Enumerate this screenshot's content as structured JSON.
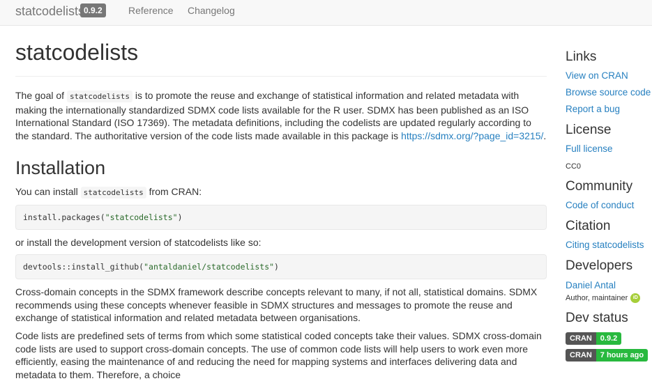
{
  "navbar": {
    "brand": "statcodelists",
    "version": "0.9.2",
    "links": [
      "Reference",
      "Changelog"
    ]
  },
  "main": {
    "title": "statcodelists",
    "intro": {
      "before_code": "The goal of ",
      "code": "statcodelists",
      "after_code": " is to promote the reuse and exchange of statistical information and related metadata with making the internationally standardized SDMX code lists available for the R user. SDMX has been published as an ISO International Standard (ISO 17369). The metadata definitions, including the codelists are updated regularly according to the standard. The authoritative version of the code lists made available in this package is ",
      "link": "https://sdmx.org/?page_id=3215/",
      "end": "."
    },
    "installation_heading": "Installation",
    "install_text": {
      "before_code": "You can install ",
      "code": "statcodelists",
      "after_code": " from CRAN:"
    },
    "code1": {
      "fn": "install.packages(",
      "str": "\"statcodelists\"",
      "close": ")"
    },
    "dev_text": "or install the development version of statcodelists like so:",
    "code2": {
      "ns": "devtools::",
      "fn": "install_github(",
      "str": "\"antaldaniel/statcodelists\"",
      "close": ")"
    },
    "cross_domain_text": "Cross-domain concepts in the SDMX framework describe concepts relevant to many, if not all, statistical domains. SDMX recommends using these concepts whenever feasible in SDMX structures and messages to promote the reuse and exchange of statistical information and related metadata between organisations.",
    "codelists_text": "Code lists are predefined sets of terms from which some statistical coded concepts take their values. SDMX cross-domain code lists are used to support cross-domain concepts. The use of common code lists will help users to work even more efficiently, easing the maintenance of and reducing the need for mapping systems and interfaces delivering data and metadata to them. Therefore, a choice"
  },
  "sidebar": {
    "links_heading": "Links",
    "links": [
      "View on CRAN",
      "Browse source code",
      "Report a bug"
    ],
    "license_heading": "License",
    "license_link": "Full license",
    "license_value": "CC0",
    "community_heading": "Community",
    "community_link": "Code of conduct",
    "citation_heading": "Citation",
    "citation_link": "Citing statcodelists",
    "developers_heading": "Developers",
    "developer_name": "Daniel Antal",
    "developer_role": "Author, maintainer",
    "orcid_label": "iD",
    "dev_status_heading": "Dev status",
    "badges": [
      {
        "label": "CRAN",
        "value": "0.9.2",
        "color": "#28b93e"
      },
      {
        "label": "CRAN",
        "value": "7 hours ago",
        "color": "#28b93e"
      }
    ]
  }
}
